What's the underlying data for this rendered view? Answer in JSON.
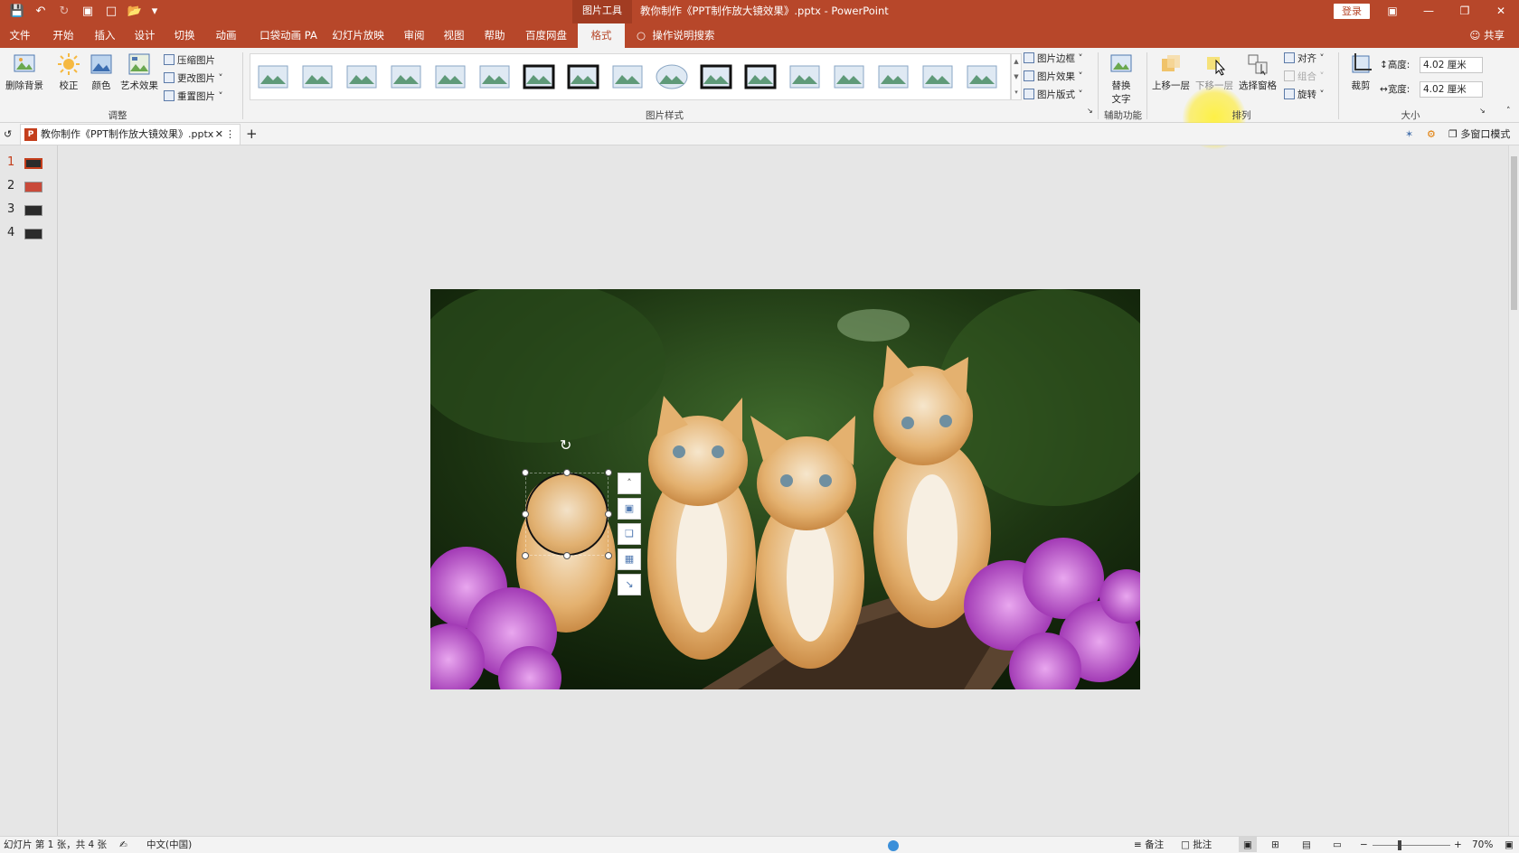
{
  "titlebar": {
    "context_tools": "图片工具",
    "doc_title": "教你制作《PPT制作放大镜效果》.pptx  -  PowerPoint",
    "login": "登录"
  },
  "tabs": {
    "file": "文件",
    "home": "开始",
    "insert": "插入",
    "design": "设计",
    "transitions": "切换",
    "animations": "动画",
    "pocket": "口袋动画 PA",
    "slideshow": "幻灯片放映",
    "review": "审阅",
    "view": "视图",
    "help": "帮助",
    "baidu": "百度网盘",
    "format": "格式",
    "tell_me": "操作说明搜索",
    "share": "共享"
  },
  "ribbon": {
    "remove_bg": "删除背景",
    "corrections": "校正",
    "color": "颜色",
    "artistic": "艺术效果",
    "compress": "压缩图片",
    "change_pic": "更改图片",
    "reset_pic": "重置图片",
    "adjust_label": "调整",
    "styles_label": "图片样式",
    "border": "图片边框",
    "effects": "图片效果",
    "layout": "图片版式",
    "alt_text_1": "替换",
    "alt_text_2": "文字",
    "accessibility_label": "辅助功能",
    "bring_forward": "上移一层",
    "send_backward": "下移一层",
    "selection_pane": "选择窗格",
    "align": "对齐",
    "group": "组合",
    "rotate": "旋转",
    "arrange_label": "排列",
    "crop": "裁剪",
    "height_label": "高度:",
    "height_value": "4.02 厘米",
    "width_label": "宽度:",
    "width_value": "4.02 厘米",
    "size_label": "大小",
    "accent_color": "#b7472a"
  },
  "doctabs": {
    "doc_name": "教你制作《PPT制作放大镜效果》.pptx",
    "multi_window": "多窗口模式"
  },
  "thumbnails": [
    {
      "num": "1",
      "selected": true
    },
    {
      "num": "2",
      "selected": false
    },
    {
      "num": "3",
      "selected": false
    },
    {
      "num": "4",
      "selected": false
    }
  ],
  "statusbar": {
    "slide_info": "幻灯片 第 1 张，共 4 张",
    "language": "中文(中国)",
    "notes": "备注",
    "comments": "批注",
    "zoom": "70%"
  }
}
